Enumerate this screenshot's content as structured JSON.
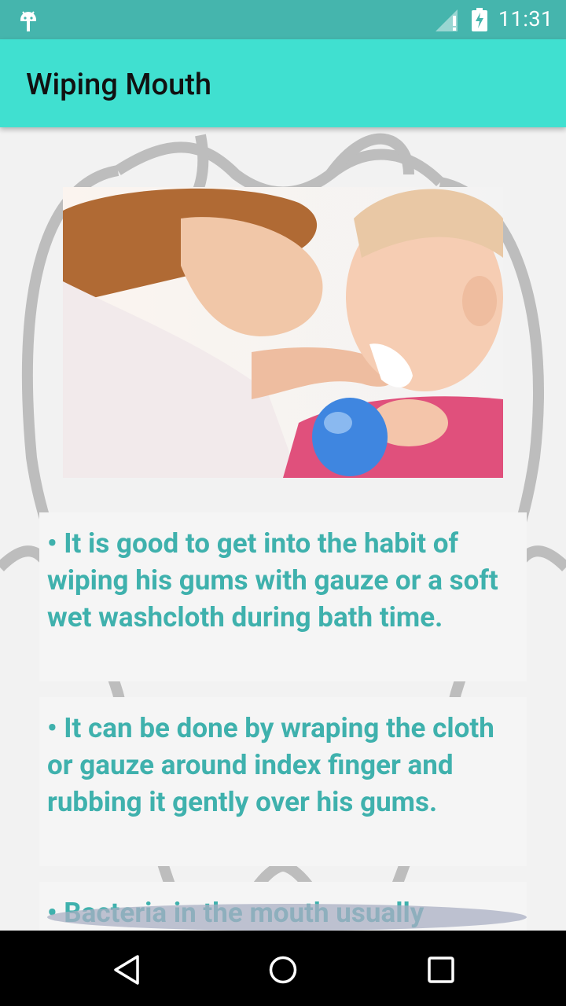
{
  "status_bar": {
    "time": "11:31",
    "icons": [
      "android-debug-icon",
      "signal-icon",
      "battery-charging-icon"
    ]
  },
  "app_bar": {
    "title": "Wiping Mouth"
  },
  "content": {
    "image": "mother-wiping-baby-mouth-photo",
    "paragraphs": [
      "• It is good to get into the habit of wiping his gums with gauze or a soft wet washcloth during bath time.",
      "• It can be done by wraping the cloth or gauze around index finger and rubbing it gently over his gums.",
      "• Bacteria in the mouth usually"
    ]
  },
  "nav_bar": {
    "icons": [
      "back-icon",
      "home-icon",
      "recents-icon"
    ]
  },
  "colors": {
    "status_bar": "#45b5ad",
    "app_bar": "#40e0d0",
    "text_accent": "#3fb1ad"
  }
}
